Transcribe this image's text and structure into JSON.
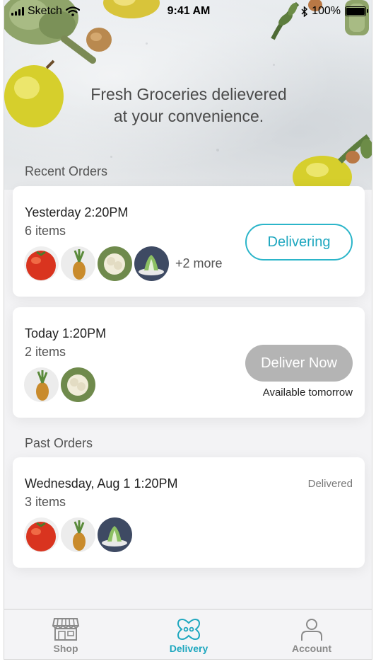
{
  "status_bar": {
    "carrier": "Sketch",
    "time": "9:41 AM",
    "battery": "100%"
  },
  "hero": {
    "title_line1": "Fresh Groceries delievered",
    "title_line2": "at your convenience."
  },
  "sections": {
    "recent": "Recent Orders",
    "past": "Past Orders"
  },
  "orders": [
    {
      "when": "Yesterday 2:20PM",
      "items": "6 items",
      "more": "+2 more",
      "action": "Delivering"
    },
    {
      "when": "Today 1:20PM",
      "items": "2 items",
      "action": "Deliver Now",
      "note": "Available tomorrow"
    },
    {
      "when": "Wednesday, Aug 1 1:20PM",
      "items": "3 items",
      "status": "Delivered"
    }
  ],
  "tabs": [
    {
      "label": "Shop",
      "icon": "store-icon"
    },
    {
      "label": "Delivery",
      "icon": "delivery-icon"
    },
    {
      "label": "Account",
      "icon": "person-icon"
    }
  ],
  "colors": {
    "accent": "#1ea7bf",
    "inactive": "#8a8a8a",
    "disabled_button": "#b4b4b4"
  }
}
